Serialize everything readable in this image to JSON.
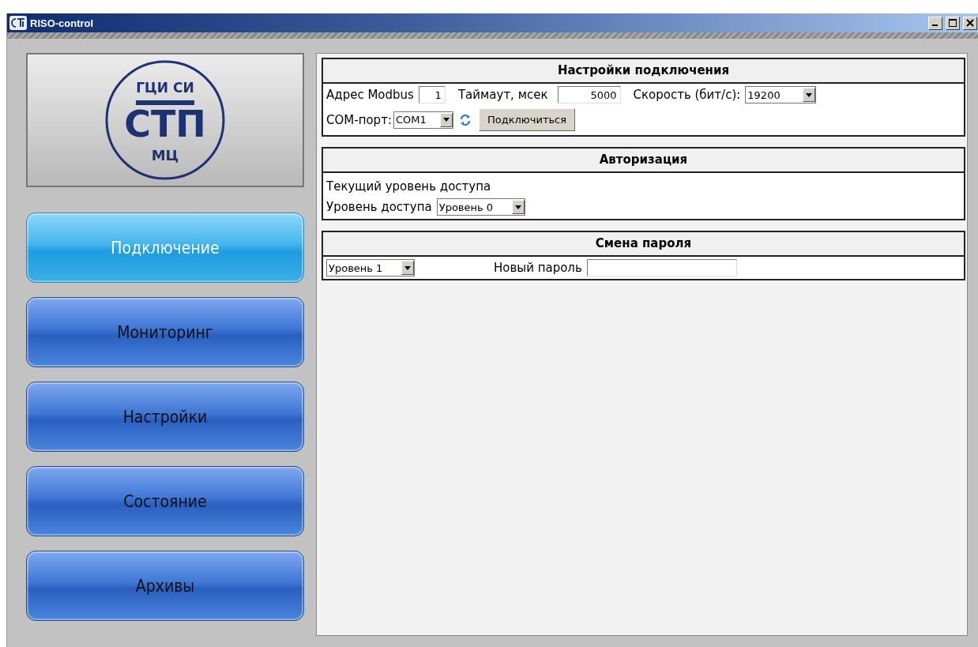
{
  "window": {
    "title": "RISO-control"
  },
  "logo": {
    "top": "ГЦИ СИ",
    "middle": "СТП",
    "bottom": "МЦ"
  },
  "nav": [
    {
      "label": "Подключение",
      "selected": true
    },
    {
      "label": "Мониторинг",
      "selected": false
    },
    {
      "label": "Настройки",
      "selected": false
    },
    {
      "label": "Состояние",
      "selected": false
    },
    {
      "label": "Архивы",
      "selected": false
    }
  ],
  "connection": {
    "title": "Настройки подключения",
    "address_label": "Адрес Modbus",
    "address": "1",
    "timeout_label": "Таймаут, мсек",
    "timeout": "5000",
    "speed_label": "Скорость (бит/с):",
    "speed": "19200",
    "port_label": "COM-порт:",
    "port": "COM1",
    "connect_button": "Подключиться"
  },
  "authorization": {
    "title": "Авторизация",
    "current_level_label": "Текущий уровень доступа",
    "level_label": "Уровень доступа",
    "level": "Уровень 0"
  },
  "password": {
    "title": "Смена пароля",
    "level": "Уровень 1",
    "new_password_label": "Новый пароль"
  }
}
